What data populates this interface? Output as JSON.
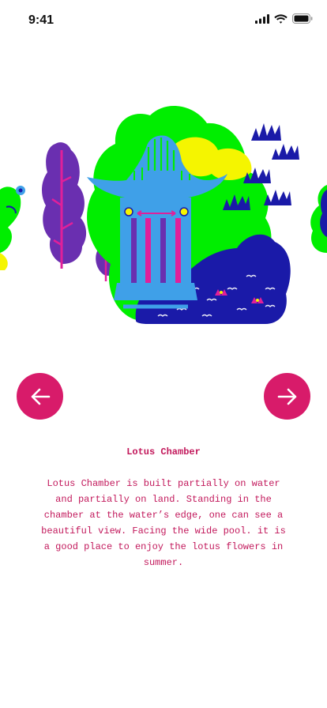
{
  "status_bar": {
    "time": "9:41"
  },
  "navigation": {
    "prev_icon": "arrow-left-icon",
    "next_icon": "arrow-right-icon"
  },
  "colors": {
    "accent": "#d81b6a",
    "text": "#c2185b",
    "green": "#00ee00",
    "yellow": "#f5f500",
    "blue": "#1a1aa8",
    "purple": "#6a2fb0",
    "sky": "#3fa0e8"
  },
  "content": {
    "title": "Lotus Chamber",
    "description": "Lotus Chamber is built partially on water and partially on land. Standing in the chamber at the water’s edge, one can see a beautiful view. Facing the wide pool. it is a good place to enjoy the lotus flowers in summer."
  }
}
